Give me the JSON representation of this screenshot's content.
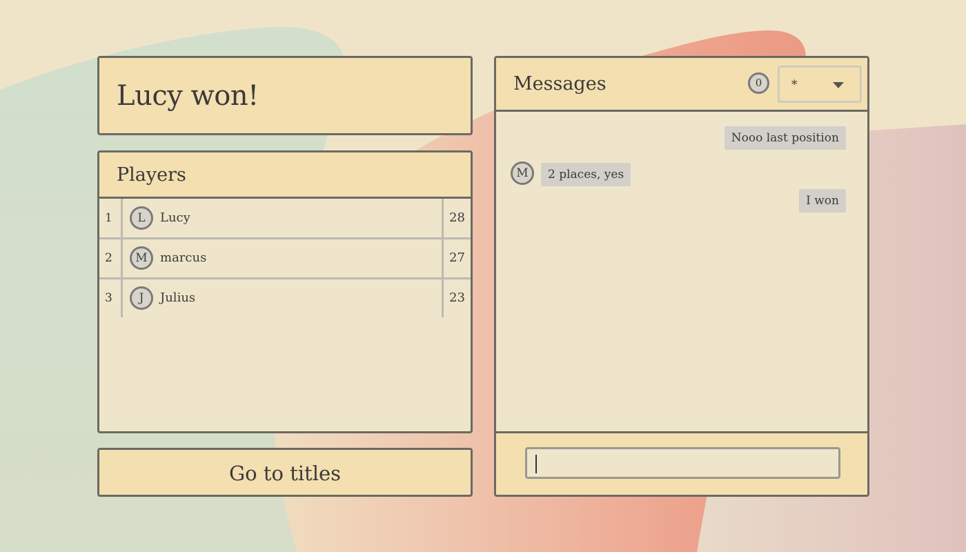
{
  "result": {
    "title": "Lucy won!"
  },
  "players": {
    "header": "Players",
    "rows": [
      {
        "rank": "1",
        "initial": "L",
        "name": "Lucy",
        "score": "28"
      },
      {
        "rank": "2",
        "initial": "M",
        "name": "marcus",
        "score": "27"
      },
      {
        "rank": "3",
        "initial": "J",
        "name": "Julius",
        "score": "23"
      }
    ]
  },
  "actions": {
    "titles_label": "Go to titles"
  },
  "messages": {
    "header": "Messages",
    "count": "0",
    "channel": "*",
    "items": [
      {
        "text": "Nooo last position",
        "side": "right"
      },
      {
        "text": "2 places, yes",
        "side": "left",
        "initial": "M"
      },
      {
        "text": "I won",
        "side": "right"
      }
    ],
    "input_value": ""
  },
  "colors": {
    "background": "#f0e4c8",
    "panel": "#efe5ca",
    "header": "#f3dfb0",
    "border": "#6b6a62",
    "bubble": "#d3d0ca",
    "blob_green": "#cfdcc8",
    "blob_coral": "#ee9e88",
    "blob_pink": "#e0c2bd"
  }
}
